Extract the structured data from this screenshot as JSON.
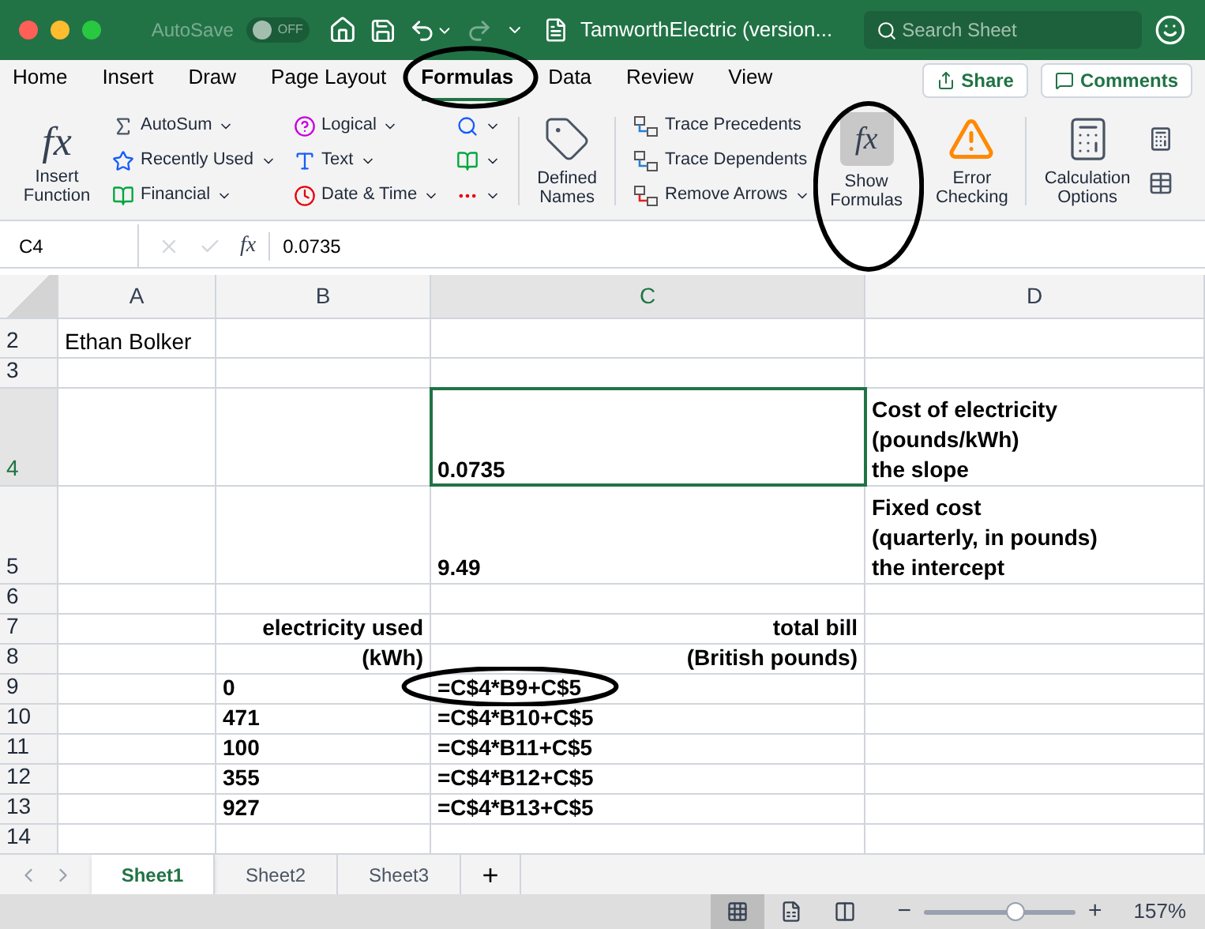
{
  "title_bar": {
    "autosave_label": "AutoSave",
    "autosave": {
      "on": false,
      "label": "OFF"
    },
    "document_title": "TamworthElectric (version...",
    "search": {
      "placeholder": "Search Sheet"
    }
  },
  "tabs": [
    {
      "label": "Home",
      "selected": false,
      "circled": false
    },
    {
      "label": "Insert",
      "selected": false,
      "circled": false
    },
    {
      "label": "Draw",
      "selected": false,
      "circled": false
    },
    {
      "label": "Page Layout",
      "selected": false,
      "circled": false
    },
    {
      "label": "Formulas",
      "selected": true,
      "circled": true
    },
    {
      "label": "Data",
      "selected": false,
      "circled": false
    },
    {
      "label": "Review",
      "selected": false,
      "circled": false
    },
    {
      "label": "View",
      "selected": false,
      "circled": false
    }
  ],
  "share_button": "Share",
  "comments_button": "Comments",
  "ribbon": {
    "insert_function_glyph": "fx",
    "insert_function": "Insert\nFunction",
    "library_columns": [
      [
        {
          "kind": "sigma",
          "label": "AutoSum"
        },
        {
          "kind": "star",
          "label": "Recently Used"
        },
        {
          "kind": "ledger",
          "label": "Financial"
        }
      ],
      [
        {
          "kind": "question",
          "label": "Logical"
        },
        {
          "kind": "letter",
          "label": "Text"
        },
        {
          "kind": "clock",
          "label": "Date & Time"
        }
      ],
      [
        {
          "kind": "lookup"
        },
        {
          "kind": "theta"
        },
        {
          "kind": "more"
        }
      ]
    ],
    "defined_names": "Defined\nNames",
    "auditing": [
      {
        "kind": "precedents",
        "label": "Trace Precedents",
        "caret": false
      },
      {
        "kind": "dependents",
        "label": "Trace Dependents",
        "caret": false
      },
      {
        "kind": "remove",
        "label": "Remove Arrows",
        "caret": true
      }
    ],
    "show_formulas": {
      "glyph": "fx",
      "label": "Show\nFormulas",
      "selected": true,
      "circled": true
    },
    "error_checking": "Error\nChecking",
    "calculation_options": "Calculation\nOptions"
  },
  "formula_bar": {
    "name_box": "C4",
    "fx_glyph": "fx",
    "formula": "0.0735"
  },
  "columns": [
    {
      "label": "A",
      "selected": false
    },
    {
      "label": "B",
      "selected": false
    },
    {
      "label": "C",
      "selected": true
    },
    {
      "label": "D",
      "selected": false
    }
  ],
  "rows": [
    {
      "number": "2",
      "selected": false,
      "cells": [
        {
          "lines": [
            "Ethan Bolker"
          ],
          "bold": false,
          "right_aligned": false,
          "circled": false
        },
        null,
        null,
        null
      ]
    },
    {
      "number": "3",
      "selected": false,
      "cells": [
        null,
        null,
        null,
        null
      ]
    },
    {
      "number": "4",
      "selected": true,
      "cells": [
        null,
        null,
        {
          "lines": [
            "0.0735"
          ],
          "bold": true,
          "right_aligned": false,
          "circled": false
        },
        {
          "lines": [
            "Cost of electricity",
            "(pounds/kWh)",
            "the slope"
          ],
          "bold": true,
          "right_aligned": false,
          "circled": false
        }
      ]
    },
    {
      "number": "5",
      "selected": false,
      "cells": [
        null,
        null,
        {
          "lines": [
            "9.49"
          ],
          "bold": true,
          "right_aligned": false,
          "circled": false
        },
        {
          "lines": [
            "Fixed cost",
            "(quarterly, in pounds)",
            "the intercept"
          ],
          "bold": true,
          "right_aligned": false,
          "circled": false
        }
      ]
    },
    {
      "number": "6",
      "selected": false,
      "cells": [
        null,
        null,
        null,
        null
      ]
    },
    {
      "number": "7",
      "selected": false,
      "cells": [
        null,
        {
          "lines": [
            "electricity used"
          ],
          "bold": true,
          "right_aligned": true,
          "circled": false
        },
        {
          "lines": [
            "total bill"
          ],
          "bold": true,
          "right_aligned": true,
          "circled": false
        },
        null
      ]
    },
    {
      "number": "8",
      "selected": false,
      "cells": [
        null,
        {
          "lines": [
            "(kWh)"
          ],
          "bold": true,
          "right_aligned": true,
          "circled": false
        },
        {
          "lines": [
            "(British pounds)"
          ],
          "bold": true,
          "right_aligned": true,
          "circled": false
        },
        null
      ]
    },
    {
      "number": "9",
      "selected": false,
      "cells": [
        null,
        {
          "lines": [
            "0"
          ],
          "bold": true,
          "right_aligned": false,
          "circled": false
        },
        {
          "lines": [
            "=C$4*B9+C$5"
          ],
          "bold": true,
          "right_aligned": false,
          "circled": true
        },
        null
      ]
    },
    {
      "number": "10",
      "selected": false,
      "cells": [
        null,
        {
          "lines": [
            "471"
          ],
          "bold": true,
          "right_aligned": false,
          "circled": false
        },
        {
          "lines": [
            "=C$4*B10+C$5"
          ],
          "bold": true,
          "right_aligned": false,
          "circled": false
        },
        null
      ]
    },
    {
      "number": "11",
      "selected": false,
      "cells": [
        null,
        {
          "lines": [
            "100"
          ],
          "bold": true,
          "right_aligned": false,
          "circled": false
        },
        {
          "lines": [
            "=C$4*B11+C$5"
          ],
          "bold": true,
          "right_aligned": false,
          "circled": false
        },
        null
      ]
    },
    {
      "number": "12",
      "selected": false,
      "cells": [
        null,
        {
          "lines": [
            "355"
          ],
          "bold": true,
          "right_aligned": false,
          "circled": false
        },
        {
          "lines": [
            "=C$4*B12+C$5"
          ],
          "bold": true,
          "right_aligned": false,
          "circled": false
        },
        null
      ]
    },
    {
      "number": "13",
      "selected": false,
      "cells": [
        null,
        {
          "lines": [
            "927"
          ],
          "bold": true,
          "right_aligned": false,
          "circled": false
        },
        {
          "lines": [
            "=C$4*B13+C$5"
          ],
          "bold": true,
          "right_aligned": false,
          "circled": false
        },
        null
      ]
    },
    {
      "number": "14",
      "selected": false,
      "cells": [
        null,
        null,
        null,
        null
      ]
    }
  ],
  "sheet_tabs": [
    {
      "label": "Sheet1",
      "selected": true
    },
    {
      "label": "Sheet2",
      "selected": false
    },
    {
      "label": "Sheet3",
      "selected": false
    }
  ],
  "add_sheet": "+",
  "status_bar": {
    "views": [
      {
        "kind": "normal",
        "selected": true
      },
      {
        "kind": "page",
        "selected": false
      },
      {
        "kind": "break",
        "selected": false
      }
    ],
    "zoom_out": "−",
    "zoom_in": "+",
    "zoom": {
      "level": 0.6
    },
    "zoom_reading": "157%"
  }
}
